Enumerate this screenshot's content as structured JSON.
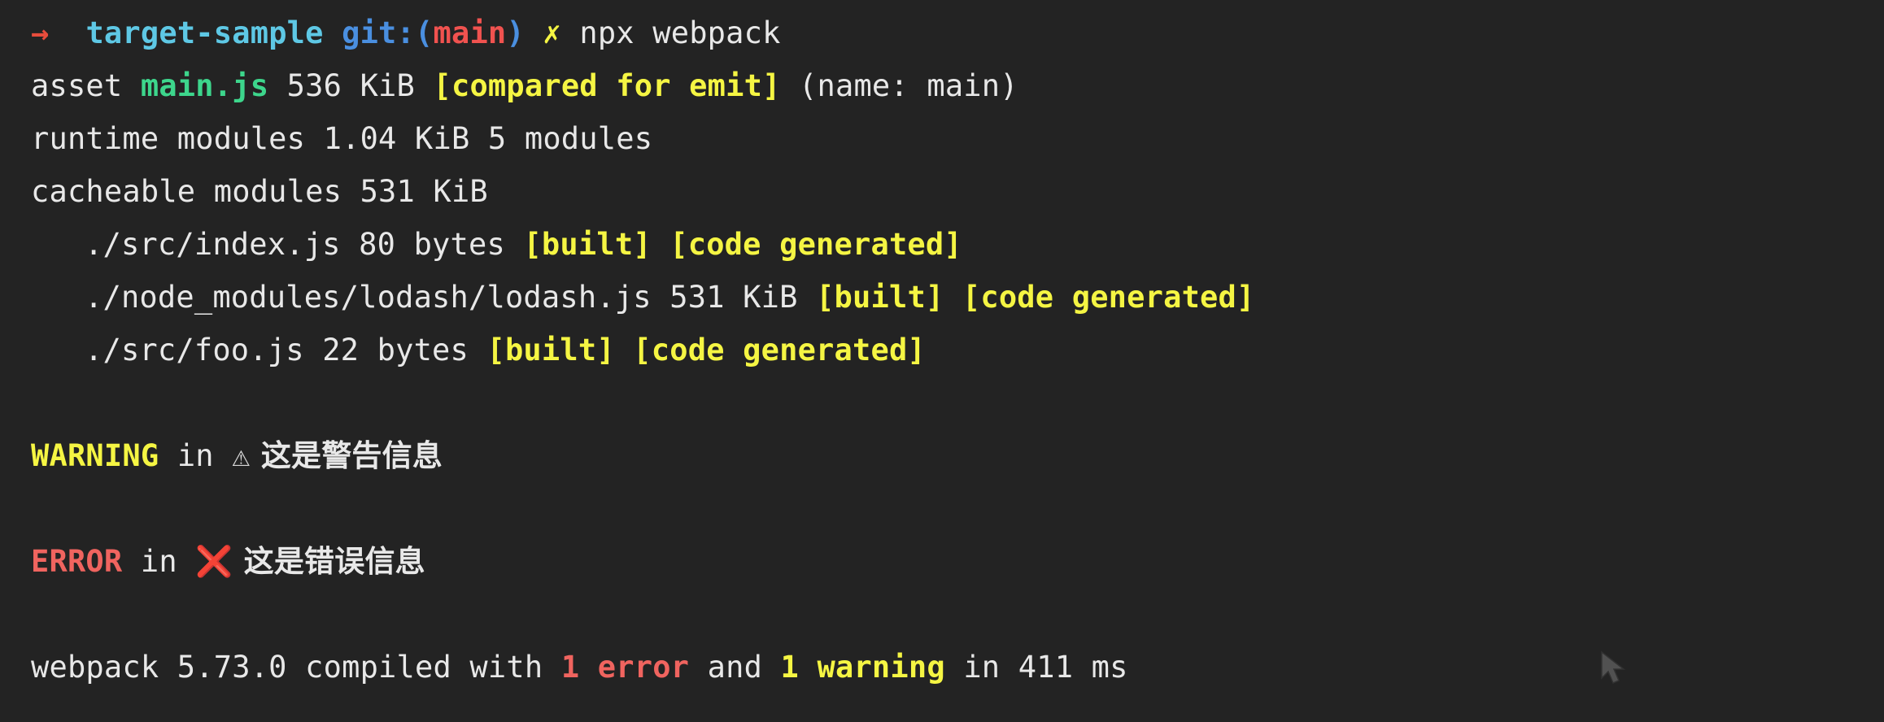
{
  "terminal": {
    "background_color": "#232323",
    "foreground_color": "#e8e8e8",
    "palette": {
      "cyan": "#5ec8e5",
      "blue": "#4a8fe0",
      "red": "#f0524f",
      "yellow": "#f5f543",
      "green": "#3dd68c",
      "white": "#e8e8e8",
      "error_red": "#f0645f",
      "arrow_red": "#e74c3c"
    }
  },
  "prompt": {
    "arrow": "→",
    "directory": "target-sample",
    "git_open": "git:(",
    "git_branch": "main",
    "git_close": ")",
    "status_mark": "✗",
    "command": "npx webpack"
  },
  "output": {
    "asset_line": {
      "label": "asset ",
      "name": "main.js",
      "size": " 536 KiB ",
      "tag": "[compared for emit]",
      "suffix": " (name: main)"
    },
    "runtime_modules": "runtime modules 1.04 KiB 5 modules",
    "cacheable_modules": "cacheable modules 531 KiB",
    "modules": [
      {
        "path": "./src/index.js",
        "size": " 80 bytes ",
        "tags": "[built] [code generated]"
      },
      {
        "path": "./node_modules/lodash/lodash.js",
        "size": " 531 KiB ",
        "tags": "[built] [code generated]"
      },
      {
        "path": "./src/foo.js",
        "size": " 22 bytes ",
        "tags": "[built] [code generated]"
      }
    ],
    "warning": {
      "keyword": "WARNING",
      "in": " in ",
      "icon": "⚠",
      "message": " 这是警告信息"
    },
    "error": {
      "keyword": "ERROR",
      "in": " in ",
      "icon": "❌",
      "message": " 这是错误信息"
    },
    "summary": {
      "prefix": "webpack 5.73.0 compiled with ",
      "error_count": "1 error",
      "joiner": " and ",
      "warning_count": "1 warning",
      "suffix": " in 411 ms"
    }
  }
}
